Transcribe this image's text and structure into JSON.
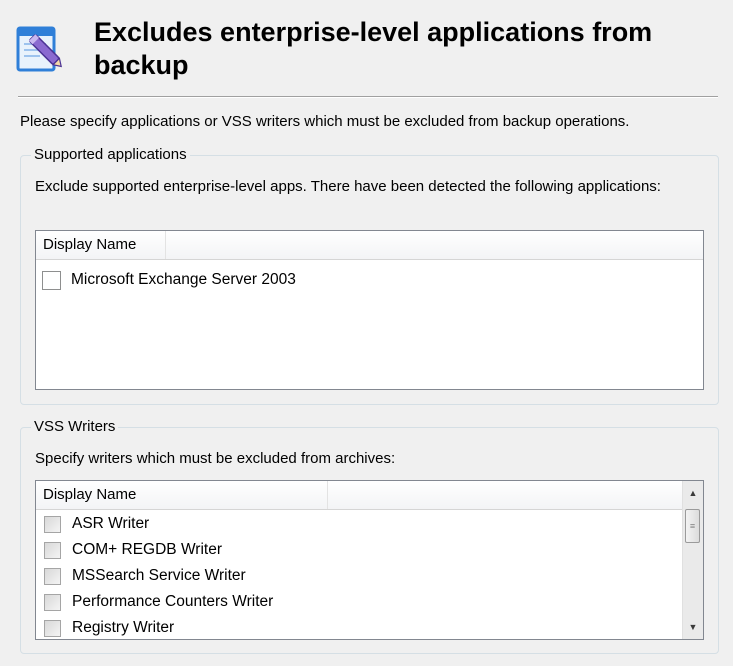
{
  "header": {
    "title": "Excludes enterprise-level applications from backup"
  },
  "instruction": "Please specify applications or VSS writers which must be excluded from backup operations.",
  "supported_apps": {
    "legend": "Supported applications",
    "description": "Exclude supported enterprise-level apps. There have been detected the following applications:",
    "column_header": "Display Name",
    "items": [
      {
        "label": "Microsoft Exchange Server 2003",
        "checked": false
      }
    ]
  },
  "vss_writers": {
    "legend": "VSS Writers",
    "description": "Specify writers which must be excluded from archives:",
    "column_header": "Display Name",
    "items": [
      {
        "label": "ASR Writer",
        "checked": false
      },
      {
        "label": "COM+ REGDB Writer",
        "checked": false
      },
      {
        "label": "MSSearch Service Writer",
        "checked": false
      },
      {
        "label": "Performance Counters Writer",
        "checked": false
      },
      {
        "label": "Registry Writer",
        "checked": false
      }
    ]
  },
  "colors": {
    "window_bg": "#f0f0f0",
    "list_bg": "#ffffff",
    "group_border": "#d5dfe5",
    "icon_blue": "#2f7fd8",
    "icon_purple": "#8a6ad0"
  },
  "icons": {
    "header": "edit-document-icon",
    "scroll_up": "scroll-up-arrow-icon",
    "scroll_down": "scroll-down-arrow-icon",
    "scroll_grip": "scroll-grip-icon"
  }
}
